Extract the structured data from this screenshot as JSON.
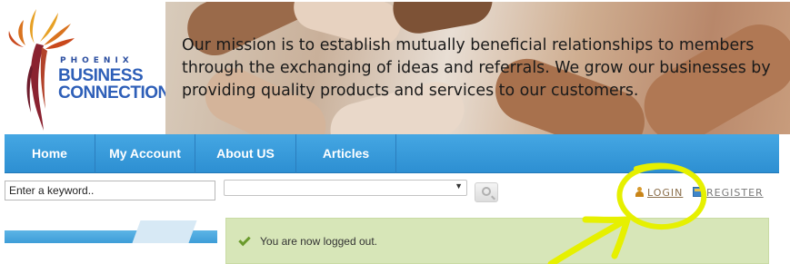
{
  "logo": {
    "small_text": "PHOENIX",
    "big_line1": "BUSINESS",
    "big_line2": "CONNECTION"
  },
  "banner": {
    "mission": "Our mission is to establish mutually beneficial relationships to members through the exchanging of ideas and referrals. We grow our businesses by providing quality products and services to our customers."
  },
  "nav": {
    "items": [
      {
        "label": "Home"
      },
      {
        "label": "My Account"
      },
      {
        "label": "About US"
      },
      {
        "label": "Articles"
      }
    ]
  },
  "search": {
    "value": "Enter a keyword..",
    "category_value": "",
    "button_icon": "search-icon"
  },
  "auth": {
    "login_label": "LOGIN",
    "register_label": "REGISTER",
    "login_icon": "user-icon",
    "register_icon": "register-icon"
  },
  "notice": {
    "message": "You are now logged out.",
    "icon": "check-icon"
  },
  "colors": {
    "nav_blue": "#2d8fd2",
    "notice_green": "#d7e6b8",
    "annotation_yellow": "#e6f000"
  }
}
